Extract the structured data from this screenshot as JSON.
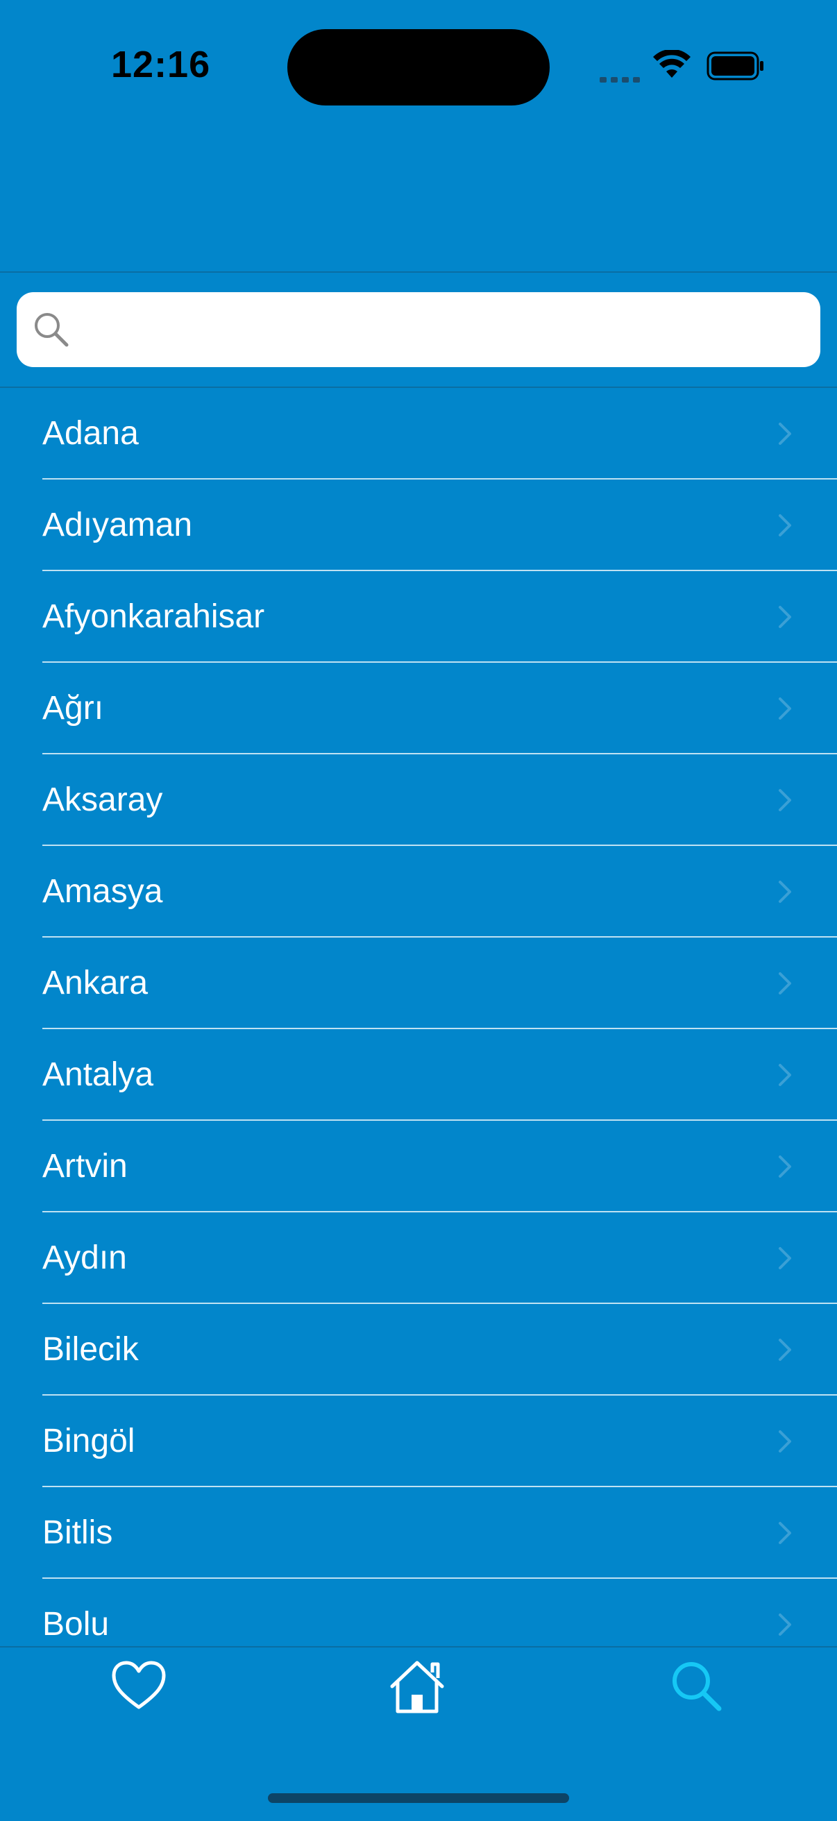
{
  "status": {
    "time": "12:16"
  },
  "search": {
    "placeholder": "",
    "value": ""
  },
  "cities": [
    "Adana",
    "Adıyaman",
    "Afyonkarahisar",
    "Ağrı",
    "Aksaray",
    "Amasya",
    "Ankara",
    "Antalya",
    "Artvin",
    "Aydın",
    "Bilecik",
    "Bingöl",
    "Bitlis",
    "Bolu"
  ],
  "tabs": [
    {
      "name": "favorites",
      "icon": "heart-icon",
      "selected": false
    },
    {
      "name": "home",
      "icon": "home-icon",
      "selected": false
    },
    {
      "name": "search",
      "icon": "search-icon",
      "selected": true
    }
  ],
  "colors": {
    "background": "#0286CB",
    "selected_tab": "#16C8F5",
    "text": "#FFFFFF"
  }
}
